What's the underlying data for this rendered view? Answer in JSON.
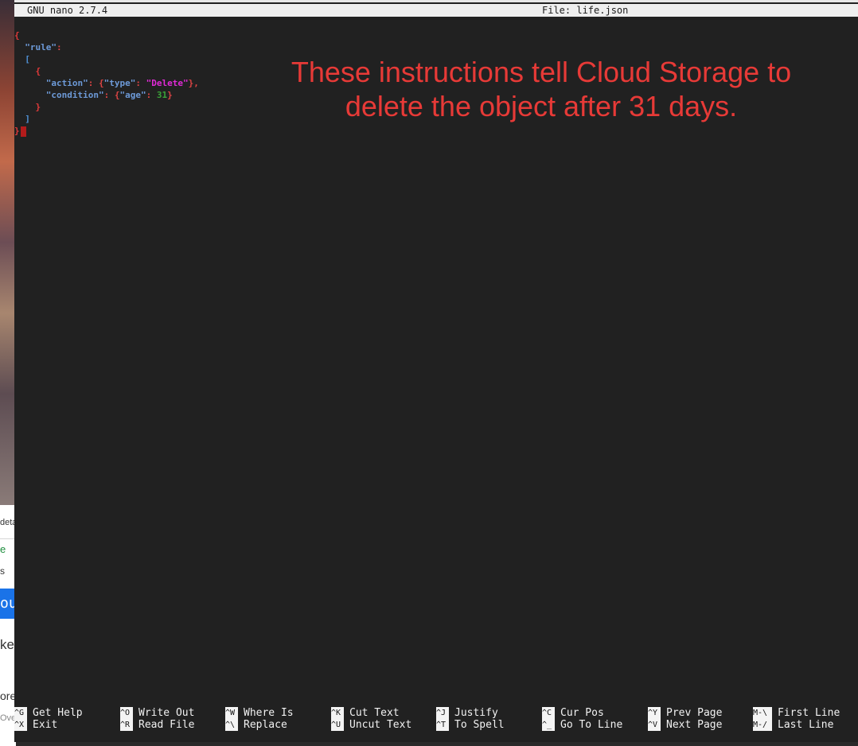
{
  "background_window": {
    "snippets": [
      "deta",
      "e",
      "s",
      "ouc",
      "ke",
      "ore",
      "Ove"
    ]
  },
  "titlebar": {
    "app_version": "GNU nano 2.7.4",
    "file_label": "File: life.json"
  },
  "editor": {
    "line1": {
      "brace": "{"
    },
    "line2": {
      "key": "\"rule\"",
      "colon": ":"
    },
    "line3": {
      "bracket": "["
    },
    "line4": {
      "brace": "{"
    },
    "line5": {
      "key": "\"action\"",
      "sep": ": {",
      "inner_key": "\"type\"",
      "colon": ": ",
      "value": "\"Delete\"",
      "close": "},"
    },
    "line6": {
      "key": "\"condition\"",
      "sep": ": {",
      "inner_key": "\"age\"",
      "colon": ": ",
      "value": "31",
      "close": "}"
    },
    "line7": {
      "brace": "}"
    },
    "line8": {
      "bracket": "]"
    },
    "line9": {
      "brace": "}"
    }
  },
  "annotation": {
    "line1": "These instructions tell Cloud Storage to",
    "line2": "delete the object after 31 days."
  },
  "colors": {
    "terminal_bg": "#212121",
    "annotation": "#e73a37",
    "json_key": "#6d9ad8",
    "json_string": "#e02ad6",
    "json_number": "#3aa338",
    "json_brace": "#e33a3a",
    "cursor": "#b31b1b"
  },
  "shortcuts": [
    {
      "key": "^G",
      "label": "Get Help"
    },
    {
      "key": "^X",
      "label": "Exit"
    },
    {
      "key": "^O",
      "label": "Write Out"
    },
    {
      "key": "^R",
      "label": "Read File"
    },
    {
      "key": "^W",
      "label": "Where Is"
    },
    {
      "key": "^\\",
      "label": "Replace"
    },
    {
      "key": "^K",
      "label": "Cut Text"
    },
    {
      "key": "^U",
      "label": "Uncut Text"
    },
    {
      "key": "^J",
      "label": "Justify"
    },
    {
      "key": "^T",
      "label": "To Spell"
    },
    {
      "key": "^C",
      "label": "Cur Pos"
    },
    {
      "key": "^_",
      "label": "Go To Line"
    },
    {
      "key": "^Y",
      "label": "Prev Page"
    },
    {
      "key": "^V",
      "label": "Next Page"
    },
    {
      "key": "M-\\",
      "label": "First Line"
    },
    {
      "key": "M-/",
      "label": "Last Line"
    }
  ]
}
